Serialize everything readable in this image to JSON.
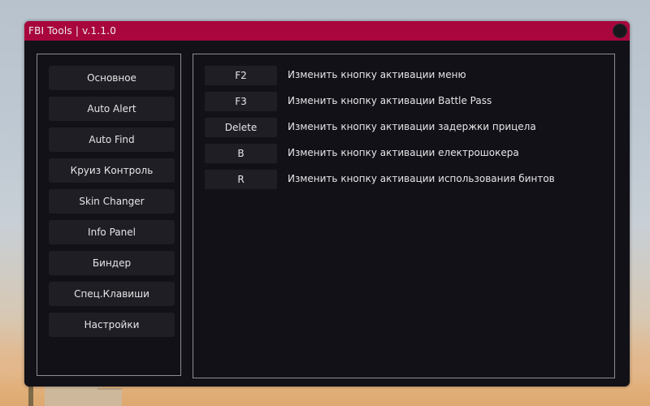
{
  "window": {
    "title": "FBI Tools | v.1.1.0"
  },
  "sidebar": {
    "items": [
      {
        "label": "Основное"
      },
      {
        "label": "Auto Alert"
      },
      {
        "label": "Auto Find"
      },
      {
        "label": "Круиз Контроль"
      },
      {
        "label": "Skin Changer"
      },
      {
        "label": "Info Panel"
      },
      {
        "label": "Биндер"
      },
      {
        "label": "Спец.Клавиши"
      },
      {
        "label": "Настройки"
      }
    ]
  },
  "hotkeys": [
    {
      "key": "F2",
      "description": "Изменить кнопку активации меню"
    },
    {
      "key": "F3",
      "description": "Изменить кнопку активации Battle Pass"
    },
    {
      "key": "Delete",
      "description": "Изменить кнопку активации задержки прицела"
    },
    {
      "key": "B",
      "description": "Изменить кнопку активации електрошокера"
    },
    {
      "key": "R",
      "description": "Изменить кнопку активации использования бинтов"
    }
  ],
  "colors": {
    "titlebar": "#a8063d",
    "window_bg": "#121117",
    "button_bg": "#1f1e24",
    "panel_border": "#8c8c92"
  }
}
